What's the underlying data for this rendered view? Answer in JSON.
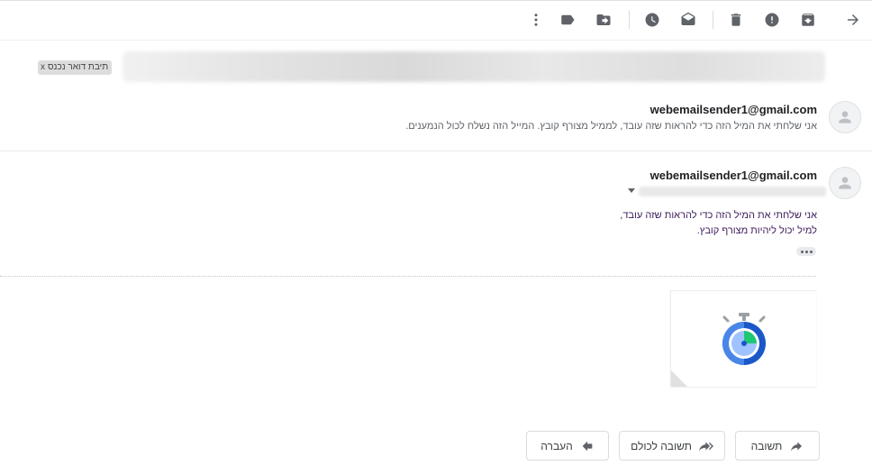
{
  "toolbar": {
    "icons": [
      "back-arrow-icon",
      "archive-icon",
      "report-spam-icon",
      "delete-icon",
      "mark-unread-icon",
      "snooze-icon",
      "move-to-icon",
      "labels-icon",
      "more-icon"
    ]
  },
  "thread": {
    "label_chip": "תיבת דואר נכנס",
    "label_chip_close": "x"
  },
  "messages": [
    {
      "sender": "webemailsender1@gmail.com",
      "snippet": "אני שלחתי את המיל הזה כדי להראות שזה עובד, לממיל מצורף קובץ. המייל הזה נשלח לכול הנמענים."
    },
    {
      "sender": "webemailsender1@gmail.com",
      "body_lines": [
        "אני שלחתי את המיל הזה כדי להראות שזה עובד,",
        "למיל יכול ליהיות מצורף קובץ."
      ]
    }
  ],
  "attachment": {
    "icon": "stopwatch-icon",
    "colors": {
      "ring": "#4a86e8",
      "inner": "#a0c3ff",
      "segment": "#1ec872",
      "dark": "#1a57c9"
    }
  },
  "actions": {
    "reply": "תשובה",
    "reply_all": "תשובה לכולם",
    "forward": "העברה"
  }
}
